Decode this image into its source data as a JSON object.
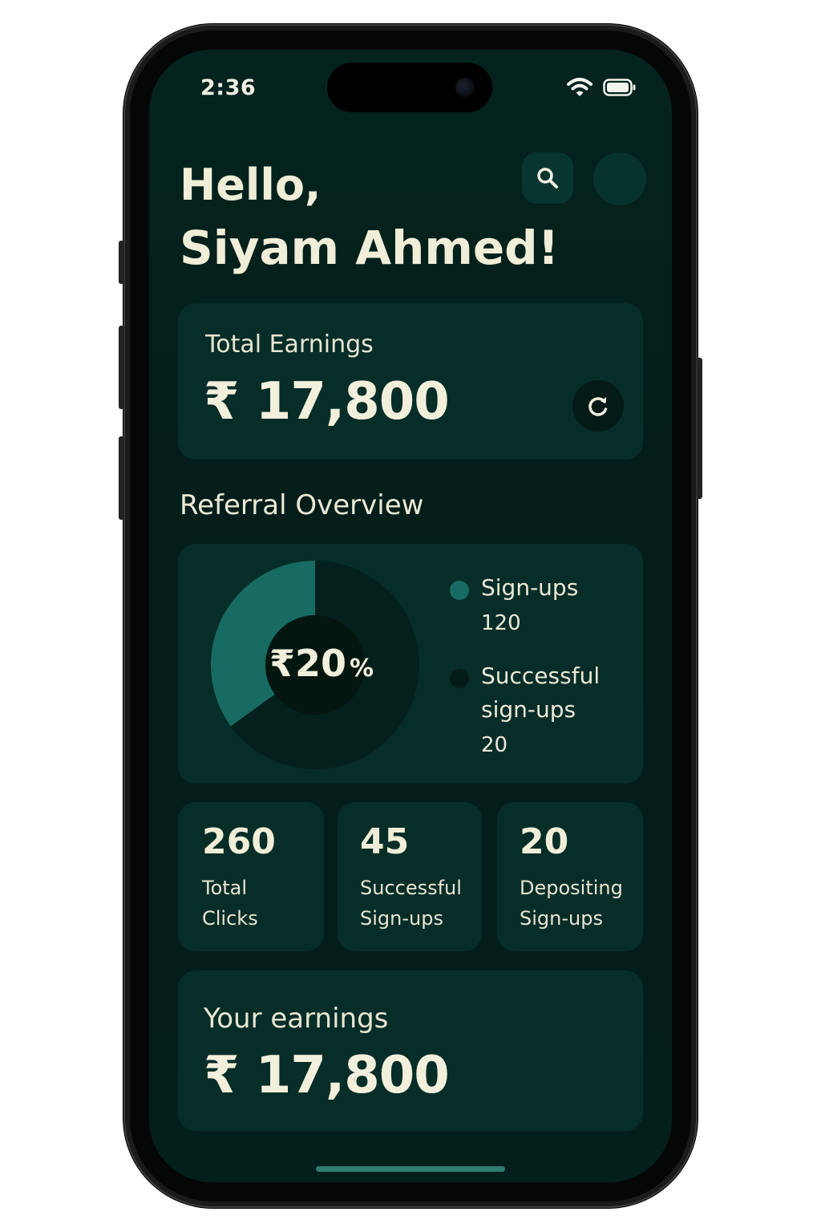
{
  "status": {
    "time": "2:36",
    "icons": [
      "wifi-icon",
      "battery-icon"
    ]
  },
  "header": {
    "greeting": "Hello,",
    "name": "Siyam Ahmed!",
    "icons": [
      "search-icon",
      "avatar"
    ]
  },
  "total_earnings": {
    "label": "Total Earnings",
    "amount": "₹ 17,800",
    "icon": "refresh-icon"
  },
  "referral_overview": {
    "title": "Referral Overview",
    "center_label": "₹20",
    "center_unit": "%",
    "sign_ups_fraction": 0.35,
    "legend": [
      {
        "label": "Sign-ups",
        "value": "120",
        "color": "#176b62"
      },
      {
        "label_line1": "Successful",
        "label_line2": "sign-ups",
        "value": "20",
        "color": "#041c18"
      }
    ]
  },
  "stats": [
    {
      "value": "260",
      "label_line1": "Total",
      "label_line2": "Clicks"
    },
    {
      "value": "45",
      "label_line1": "Successful",
      "label_line2": "Sign-ups"
    },
    {
      "value": "20",
      "label_line1": "Depositing",
      "label_line2": "Sign-ups"
    }
  ],
  "your_earnings": {
    "label": "Your earnings",
    "amount": "₹ 17,800"
  },
  "colors": {
    "background": "#031f1b",
    "card": "#072d28",
    "accent": "#176b62",
    "text": "#f0eed8"
  }
}
